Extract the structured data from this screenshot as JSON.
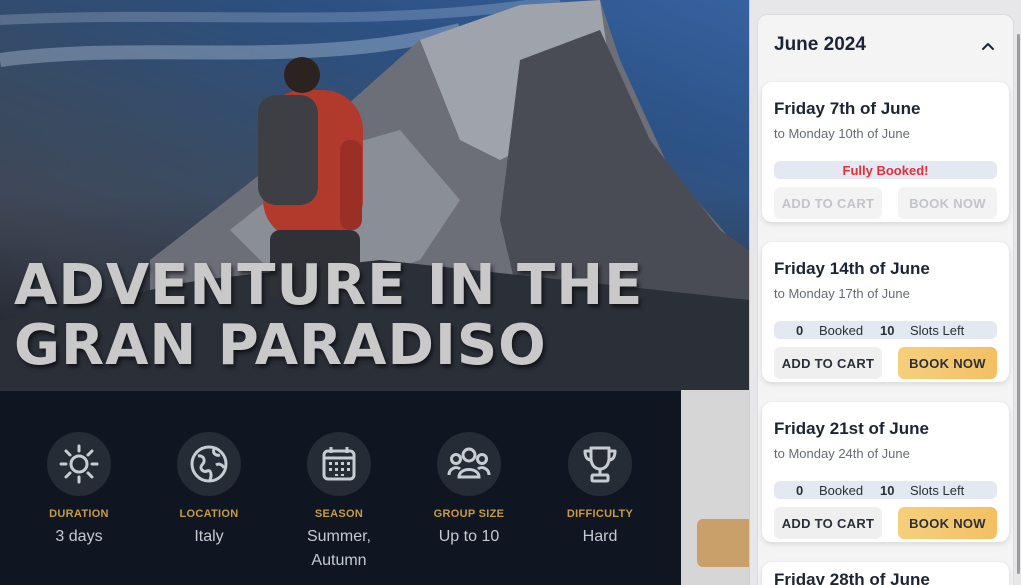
{
  "hero": {
    "title_line1": "ADVENTURE IN THE",
    "title_line2": "GRAN PARADISO"
  },
  "info": [
    {
      "icon": "sun-icon",
      "label": "DURATION",
      "value": "3 days"
    },
    {
      "icon": "globe-icon",
      "label": "LOCATION",
      "value": "Italy"
    },
    {
      "icon": "calendar-icon",
      "label": "SEASON",
      "value": "Summer, Autumn"
    },
    {
      "icon": "group-icon",
      "label": "GROUP SIZE",
      "value": "Up to 10"
    },
    {
      "icon": "trophy-icon",
      "label": "DIFFICULTY",
      "value": "Hard"
    }
  ],
  "calendar": {
    "month": "June 2024",
    "dates": [
      {
        "from": "Friday 7th of June",
        "to": "to Monday 10th of June",
        "status": "Fully Booked!",
        "add_label": "ADD TO CART",
        "book_label": "BOOK NOW"
      },
      {
        "from": "Friday 14th of June",
        "to": "to Monday 17th of June",
        "booked": "0",
        "booked_label": "Booked",
        "slots": "10",
        "slots_label": "Slots Left",
        "add_label": "ADD TO CART",
        "book_label": "BOOK NOW"
      },
      {
        "from": "Friday 21st of June",
        "to": "to Monday 24th of June",
        "booked": "0",
        "booked_label": "Booked",
        "slots": "10",
        "slots_label": "Slots Left",
        "add_label": "ADD TO CART",
        "book_label": "BOOK NOW"
      },
      {
        "from": "Friday 28th of June"
      }
    ]
  },
  "colors": {
    "accent": "#c79a46",
    "book_button": "#f3c063",
    "full_booked": "#e0313b"
  }
}
